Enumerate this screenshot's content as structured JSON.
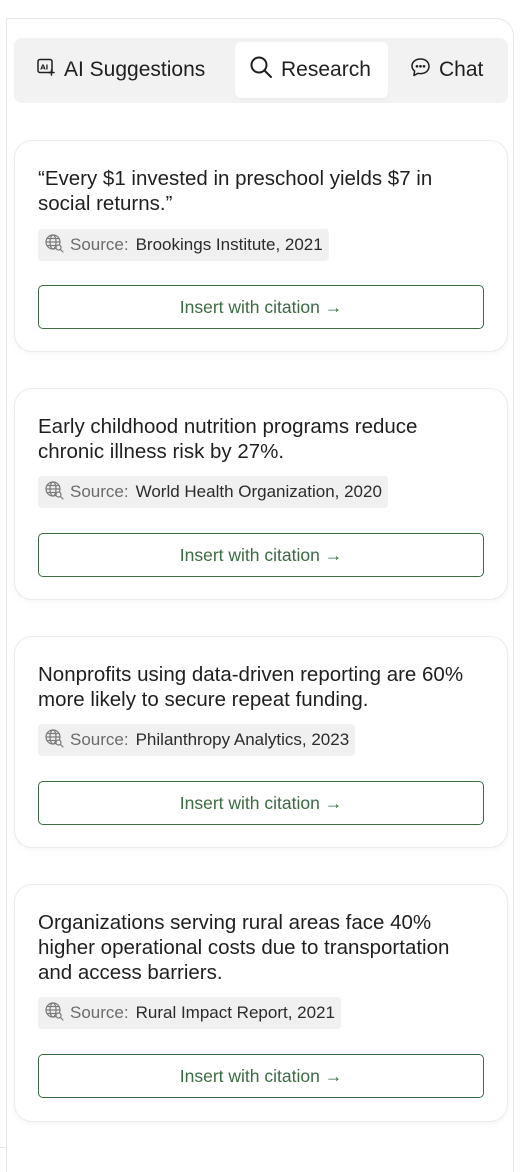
{
  "tabs": {
    "ai_suggestions": "AI Suggestions",
    "research": "Research",
    "chat": "Chat",
    "active": "research"
  },
  "source_label": "Source:",
  "accent_color": "#3d6b45",
  "cards": [
    {
      "text": "“Every $1 invested in preschool yields $7 in social returns.”",
      "source": "Brookings Institute, 2021",
      "button": "Insert with citation →"
    },
    {
      "text": "Early childhood nutrition programs reduce chronic illness risk by 27%.",
      "source": "World Health Organization, 2020",
      "button": "Insert with citation →"
    },
    {
      "text": "Nonprofits using data-driven reporting are 60% more likely to secure repeat funding.",
      "source": "Philanthropy Analytics, 2023",
      "button": "Insert with citation →"
    },
    {
      "text": "Organizations serving rural areas face 40% higher operational costs due to transportation and access barriers.",
      "source": "Rural Impact Report, 2021",
      "button": "Insert with citation →"
    }
  ]
}
